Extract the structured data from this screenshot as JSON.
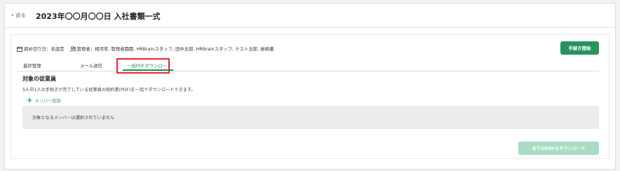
{
  "header": {
    "back_label": "戻る",
    "title": "2023年〇〇月〇〇日 入社書類一式"
  },
  "meta": {
    "deadline": "締め切り日：未設定",
    "managers": "管理者：相河孝, 管理者園園, HRBrainスタッフ, 田中太郎, HRBrainスタッフ, テスト太郎, 岩崎徹"
  },
  "actions": {
    "start_label": "手続き開始",
    "download_all_label": "全てのPDFをダウンロード"
  },
  "tabs": [
    {
      "label": "進捗管理",
      "active": false
    },
    {
      "label": "メール送信",
      "active": false
    },
    {
      "label": "一括PDFダウンロード",
      "active": true
    }
  ],
  "section": {
    "title": "対象の従業員",
    "description": "5人中1人の手続きが完了している従業員の契約書(PDF)を一括でダウンロードできます。",
    "add_member_label": "メンバー追加",
    "empty_message": "対象となるメンバーは選択されていません"
  },
  "colors": {
    "accent": "#28925c",
    "accent_disabled": "#a9dcc3",
    "highlight": "#e2252b"
  }
}
